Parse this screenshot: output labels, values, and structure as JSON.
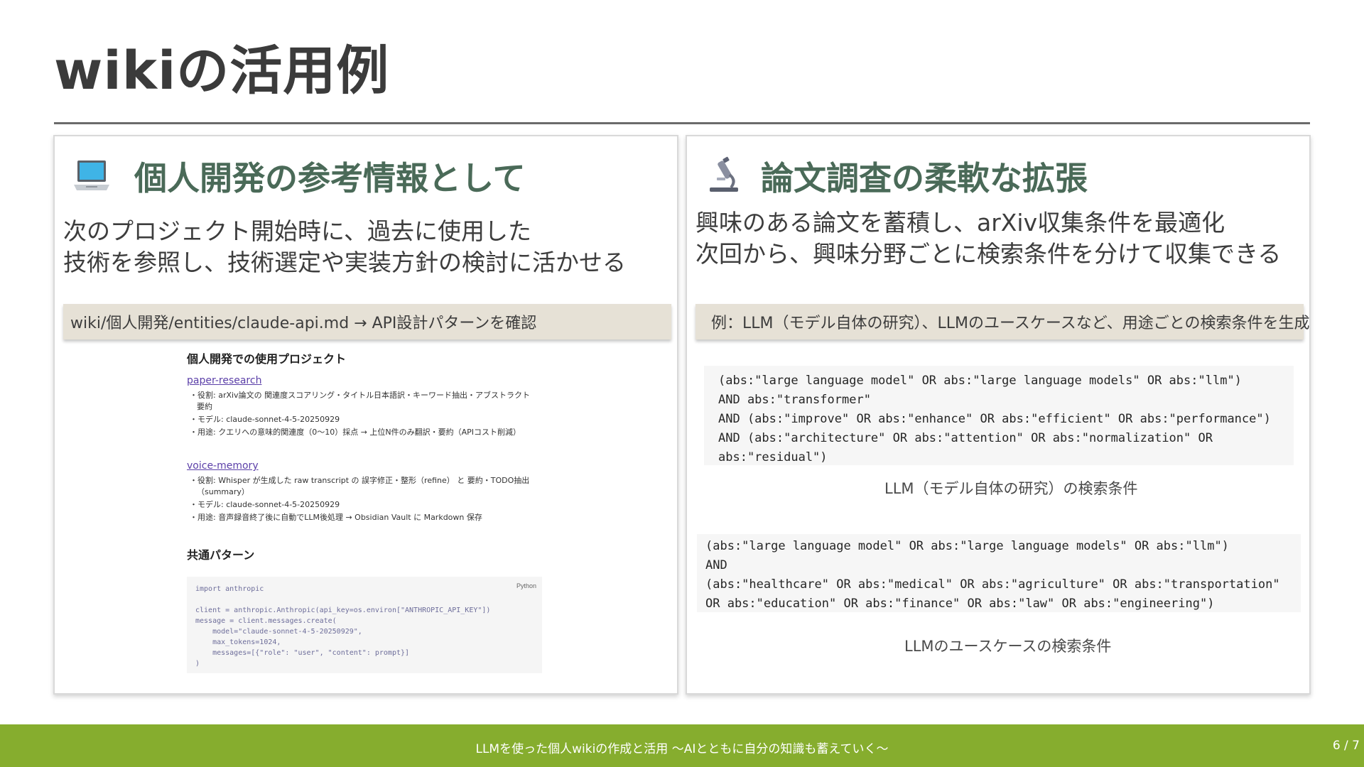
{
  "slide": {
    "title": "wikiの活用例",
    "footer_text": "LLMを使った個人wikiの作成と活用 〜AIとともに自分の知識も蓄えていく〜",
    "page_indicator": "6 / 7"
  },
  "left": {
    "icon": "laptop-icon",
    "heading": "個人開発の参考情報として",
    "desc_line1": "次のプロジェクト開始時に、過去に使用した",
    "desc_line2": "技術を参照し、技術選定や実装方針の検討に活かせる",
    "note": "wiki/個人開発/entities/claude-api.md → API設計パターンを確認",
    "shot": {
      "heading": "個人開発での使用プロジェクト",
      "p1_link": "paper-research",
      "p1_l1": "・役割: arXiv論文の 関連度スコアリング・タイトル日本語訳・キーワード抽出・アブストラクト",
      "p1_l2": "要約",
      "p1_l3": "・モデル: claude-sonnet-4-5-20250929",
      "p1_l4": "・用途: クエリへの意味的関連度（0〜10）採点 → 上位N件のみ翻訳・要約（APIコスト削減）",
      "p2_link": "voice-memory",
      "p2_l1": "・役割: Whisper が生成した raw transcript の 誤字修正・整形（refine） と 要約・TODO抽出",
      "p2_l2": "（summary）",
      "p2_l3": "・モデル: claude-sonnet-4-5-20250929",
      "p2_l4": "・用途: 音声録音終了後に自動でLLM後処理 → Obsidian Vault に Markdown 保存",
      "common_heading": "共通パターン",
      "code_lang": "Python",
      "code_l1": "import anthropic",
      "code_l2": "",
      "code_l3": "client = anthropic.Anthropic(api_key=os.environ[\"ANTHROPIC_API_KEY\"])",
      "code_l4": "message = client.messages.create(",
      "code_l5": "    model=\"claude-sonnet-4-5-20250929\",",
      "code_l6": "    max_tokens=1024,",
      "code_l7": "    messages=[{\"role\": \"user\", \"content\": prompt}]",
      "code_l8": ")"
    }
  },
  "right": {
    "icon": "microscope-icon",
    "heading": "論文調査の柔軟な拡張",
    "desc_line1": "興味のある論文を蓄積し、arXiv収集条件を最適化",
    "desc_line2": "次回から、興味分野ごとに検索条件を分けて収集できる",
    "note": "例：LLM（モデル自体の研究）、LLMのユースケースなど、用途ごとの検索条件を生成",
    "query1_l1": "(abs:\"large language model\" OR abs:\"large language models\" OR abs:\"llm\")",
    "query1_l2": "AND abs:\"transformer\"",
    "query1_l3": "AND (abs:\"improve\" OR abs:\"enhance\" OR abs:\"efficient\" OR abs:\"performance\")",
    "query1_l4": "AND (abs:\"architecture\" OR abs:\"attention\" OR abs:\"normalization\" OR",
    "query1_l5": "abs:\"residual\")",
    "query1_caption": "LLM（モデル自体の研究）の検索条件",
    "query2_l1": "(abs:\"large language model\" OR abs:\"large language models\" OR abs:\"llm\")",
    "query2_l2": "AND",
    "query2_l3": "(abs:\"healthcare\" OR abs:\"medical\" OR abs:\"agriculture\" OR abs:\"transportation\"",
    "query2_l4": "OR abs:\"education\" OR abs:\"finance\" OR abs:\"law\" OR abs:\"engineering\")",
    "query2_caption": "LLMのユースケースの検索条件"
  }
}
